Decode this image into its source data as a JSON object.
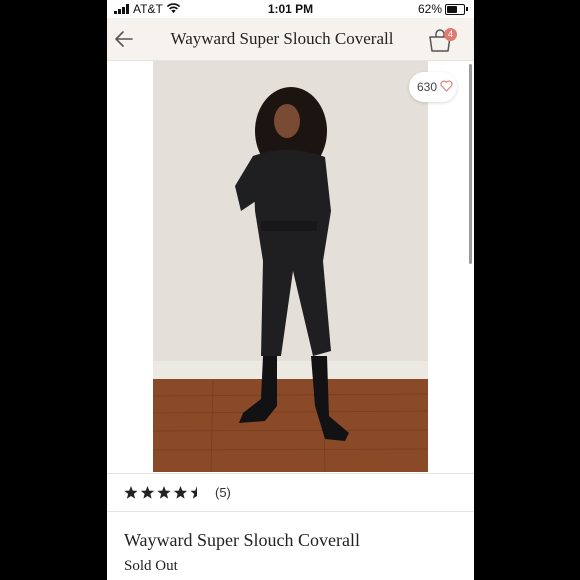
{
  "status_bar": {
    "carrier": "AT&T",
    "time": "1:01 PM",
    "battery_percent_label": "62%",
    "battery_level": 0.62
  },
  "nav": {
    "title": "Wayward Super Slouch Coverall",
    "back_icon": "arrow-left-icon",
    "bag_icon": "shopping-bag-icon",
    "bag_count": "4"
  },
  "product_image": {
    "likes": "630",
    "heart_icon": "heart-outline-icon"
  },
  "rating": {
    "stars": 4.5,
    "count_label": "(5)"
  },
  "product": {
    "title": "Wayward Super Slouch Coverall",
    "status": "Sold Out"
  },
  "colors": {
    "nav_bg": "#f6f3ee",
    "badge": "#e07b72",
    "heart": "#d9847b"
  }
}
